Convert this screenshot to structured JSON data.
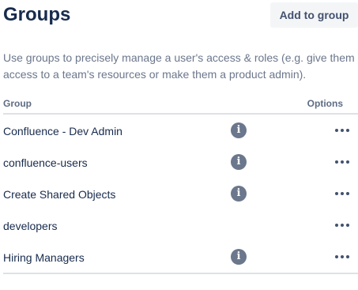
{
  "header": {
    "title": "Groups",
    "add_button_label": "Add to group"
  },
  "description": "Use groups to precisely manage a user's access & roles (e.g. give them access to a team's resources or make them a product admin).",
  "table": {
    "columns": {
      "group": "Group",
      "options": "Options"
    },
    "rows": [
      {
        "name": "Confluence - Dev Admin",
        "has_info": true
      },
      {
        "name": "confluence-users",
        "has_info": true
      },
      {
        "name": "Create Shared Objects",
        "has_info": true
      },
      {
        "name": "developers",
        "has_info": false
      },
      {
        "name": "Hiring Managers",
        "has_info": true
      }
    ],
    "info_icon_glyph": "i"
  }
}
